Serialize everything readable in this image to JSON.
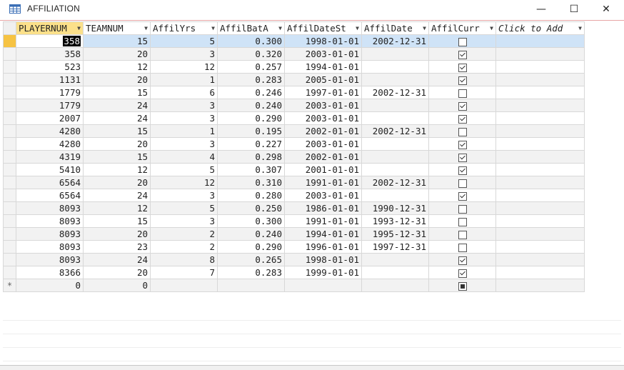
{
  "window": {
    "title": "AFFILIATION",
    "minimize_glyph": "—",
    "maximize_glyph": "☐",
    "close_glyph": "✕"
  },
  "colors": {
    "selected_header": "#fbe08a",
    "selected_row": "#cfe3f7",
    "title_accent": "#e7a6a6"
  },
  "columns": [
    "PLAYERNUM",
    "TEAMNUM",
    "AffilYrs",
    "AffilBatA",
    "AffilDateSt",
    "AffilDate",
    "AffilCurr",
    "Click to Add"
  ],
  "rows": [
    {
      "player": "358",
      "team": "15",
      "yrs": "5",
      "bat": "0.300",
      "start": "1998-01-01",
      "end": "2002-12-31",
      "curr": false
    },
    {
      "player": "358",
      "team": "20",
      "yrs": "3",
      "bat": "0.320",
      "start": "2003-01-01",
      "end": "",
      "curr": true
    },
    {
      "player": "523",
      "team": "12",
      "yrs": "12",
      "bat": "0.257",
      "start": "1994-01-01",
      "end": "",
      "curr": true
    },
    {
      "player": "1131",
      "team": "20",
      "yrs": "1",
      "bat": "0.283",
      "start": "2005-01-01",
      "end": "",
      "curr": true
    },
    {
      "player": "1779",
      "team": "15",
      "yrs": "6",
      "bat": "0.246",
      "start": "1997-01-01",
      "end": "2002-12-31",
      "curr": false
    },
    {
      "player": "1779",
      "team": "24",
      "yrs": "3",
      "bat": "0.240",
      "start": "2003-01-01",
      "end": "",
      "curr": true
    },
    {
      "player": "2007",
      "team": "24",
      "yrs": "3",
      "bat": "0.290",
      "start": "2003-01-01",
      "end": "",
      "curr": true
    },
    {
      "player": "4280",
      "team": "15",
      "yrs": "1",
      "bat": "0.195",
      "start": "2002-01-01",
      "end": "2002-12-31",
      "curr": false
    },
    {
      "player": "4280",
      "team": "20",
      "yrs": "3",
      "bat": "0.227",
      "start": "2003-01-01",
      "end": "",
      "curr": true
    },
    {
      "player": "4319",
      "team": "15",
      "yrs": "4",
      "bat": "0.298",
      "start": "2002-01-01",
      "end": "",
      "curr": true
    },
    {
      "player": "5410",
      "team": "12",
      "yrs": "5",
      "bat": "0.307",
      "start": "2001-01-01",
      "end": "",
      "curr": true
    },
    {
      "player": "6564",
      "team": "20",
      "yrs": "12",
      "bat": "0.310",
      "start": "1991-01-01",
      "end": "2002-12-31",
      "curr": false
    },
    {
      "player": "6564",
      "team": "24",
      "yrs": "3",
      "bat": "0.280",
      "start": "2003-01-01",
      "end": "",
      "curr": true
    },
    {
      "player": "8093",
      "team": "12",
      "yrs": "5",
      "bat": "0.250",
      "start": "1986-01-01",
      "end": "1990-12-31",
      "curr": false
    },
    {
      "player": "8093",
      "team": "15",
      "yrs": "3",
      "bat": "0.300",
      "start": "1991-01-01",
      "end": "1993-12-31",
      "curr": false
    },
    {
      "player": "8093",
      "team": "20",
      "yrs": "2",
      "bat": "0.240",
      "start": "1994-01-01",
      "end": "1995-12-31",
      "curr": false
    },
    {
      "player": "8093",
      "team": "23",
      "yrs": "2",
      "bat": "0.290",
      "start": "1996-01-01",
      "end": "1997-12-31",
      "curr": false
    },
    {
      "player": "8093",
      "team": "24",
      "yrs": "8",
      "bat": "0.265",
      "start": "1998-01-01",
      "end": "",
      "curr": true
    },
    {
      "player": "8366",
      "team": "20",
      "yrs": "7",
      "bat": "0.283",
      "start": "1999-01-01",
      "end": "",
      "curr": true
    }
  ],
  "new_row": {
    "marker": "*",
    "player": "0",
    "team": "0"
  }
}
